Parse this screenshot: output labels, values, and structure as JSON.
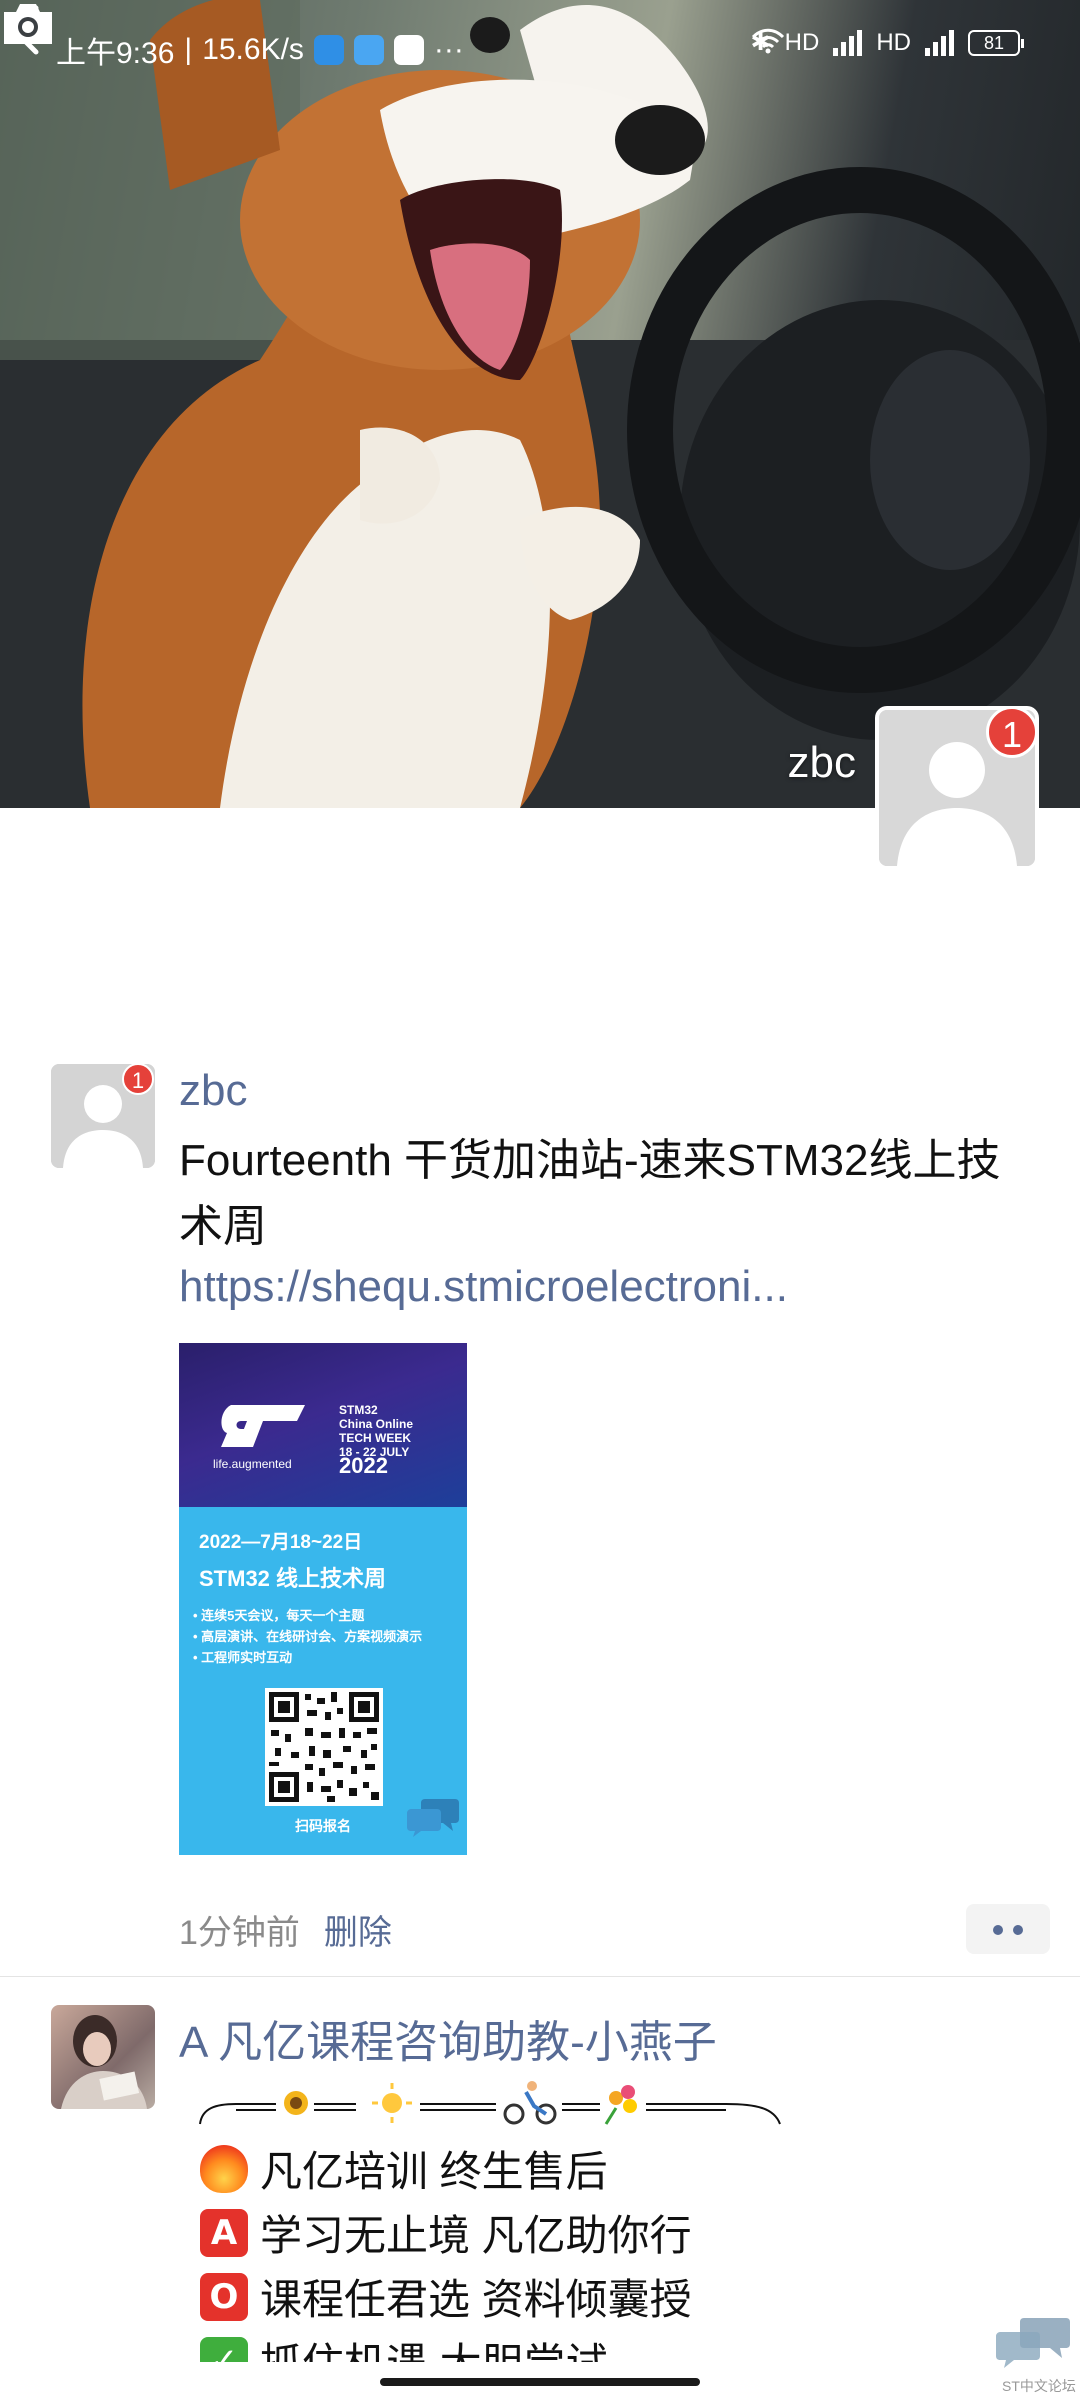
{
  "status_bar": {
    "time": "上午9:36",
    "speed": "15.6K/s",
    "more": "···",
    "hd_1": "HD",
    "hd_2": "HD",
    "battery": "81"
  },
  "cover": {
    "name": "zbc",
    "badge": "1",
    "back_icon": "chevron-left-icon",
    "camera_icon": "camera-icon"
  },
  "posts": [
    {
      "author": "zbc",
      "badge": "1",
      "text": "Fourteenth  干货加油站-速来STM32线上技术周",
      "link": "https://shequ.stmicroelectroni...",
      "image": {
        "brand_tagline": "life.augmented",
        "event_logo": [
          "STM32",
          "China Online",
          "TECH WEEK",
          "18 - 22 JULY",
          "2022"
        ],
        "date": "2022—7月18~22日",
        "title": "STM32 线上技术周",
        "bullets": [
          "• 连续5天会议，每天一个主题",
          "• 高层演讲、在线研讨会、方案视频演示",
          "• 工程师实时互动"
        ],
        "scan_label": "扫码报名"
      },
      "time": "1分钟前",
      "delete_label": "删除"
    },
    {
      "author": "A  凡亿课程咨询助教-小燕子",
      "lines": [
        {
          "emoji": "🔥",
          "text": "凡亿培训  终生售后"
        },
        {
          "emoji": "A",
          "text": "学习无止境  凡亿助你行"
        },
        {
          "emoji": "O",
          "text": "课程任君选  资料倾囊授"
        },
        {
          "emoji": "✓",
          "text": "抓住机遇  大胆尝试"
        }
      ]
    }
  ],
  "watermark": "ST中文论坛",
  "colors": {
    "link": "#576b95",
    "badge": "#e5413a",
    "poster_blue": "#39b7ec"
  }
}
